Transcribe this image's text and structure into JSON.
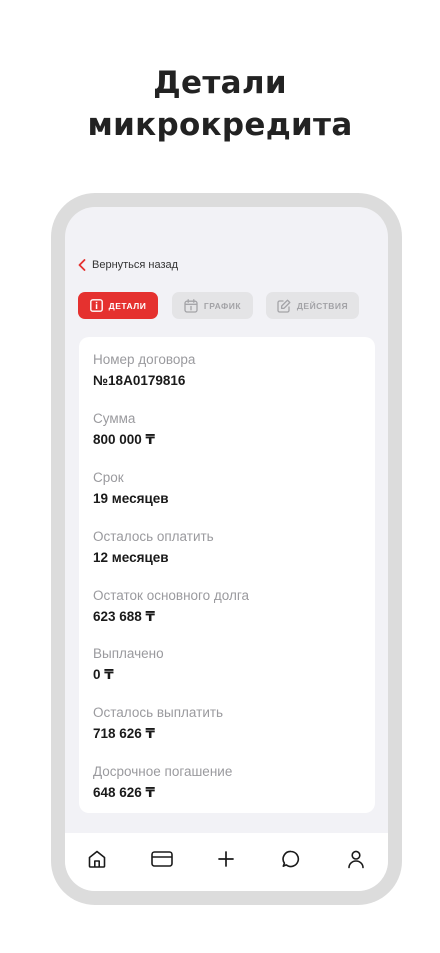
{
  "headline": {
    "line1": "Детали",
    "line2": "микрокредита"
  },
  "back": {
    "label": "Вернуться назад"
  },
  "tabs": [
    {
      "label": "ДЕТАЛИ",
      "icon": "info-icon",
      "active": true
    },
    {
      "label": "ГРАФИК",
      "icon": "calendar-icon",
      "active": false
    },
    {
      "label": "ДЕЙСТВИЯ",
      "icon": "edit-icon",
      "active": false
    }
  ],
  "details": [
    {
      "label": "Номер договора",
      "value": "№18А0179816"
    },
    {
      "label": "Сумма",
      "value": "800 000 ₸"
    },
    {
      "label": "Срок",
      "value": "19 месяцев"
    },
    {
      "label": "Осталось оплатить",
      "value": "12 месяцев"
    },
    {
      "label": "Остаток основного долга",
      "value": "623 688 ₸"
    },
    {
      "label": "Выплачено",
      "value": "0 ₸"
    },
    {
      "label": "Осталось выплатить",
      "value": "718 626 ₸"
    },
    {
      "label": "Досрочное погашение",
      "value": "648 626 ₸"
    }
  ],
  "nav": [
    "home-icon",
    "card-icon",
    "plus-icon",
    "chat-icon",
    "profile-icon"
  ],
  "colors": {
    "accent": "#e5312f",
    "screen_bg": "#f2f2f6",
    "frame": "#dcdcdc"
  }
}
